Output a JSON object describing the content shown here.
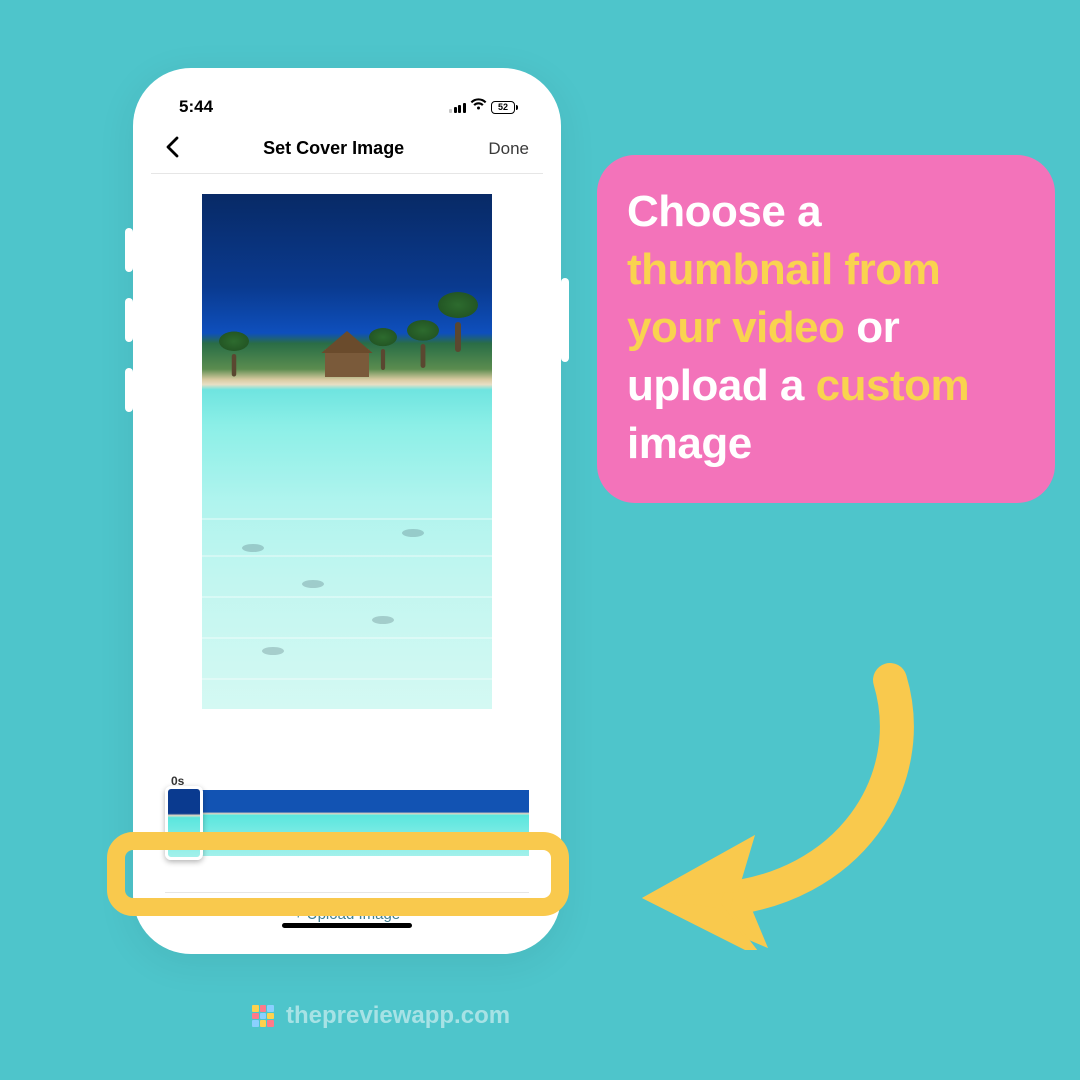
{
  "colors": {
    "page_bg": "#4EC5CB",
    "pink": "#F373BA",
    "yellow": "#F9C94D",
    "yellow_text": "#F9D34F",
    "link_teal": "#3e7f94"
  },
  "status": {
    "time": "5:44",
    "battery_pct": "52"
  },
  "nav": {
    "title": "Set Cover Image",
    "done": "Done"
  },
  "timeline": {
    "timestamp_label": "0s"
  },
  "upload_button": "+ Upload Image",
  "callout": {
    "t1": "Choose a ",
    "t2": "thumbnail from your video",
    "t3": " or upload a ",
    "t4": "custom",
    "t5": " image"
  },
  "footer": {
    "text": "thepreviewapp.com"
  }
}
